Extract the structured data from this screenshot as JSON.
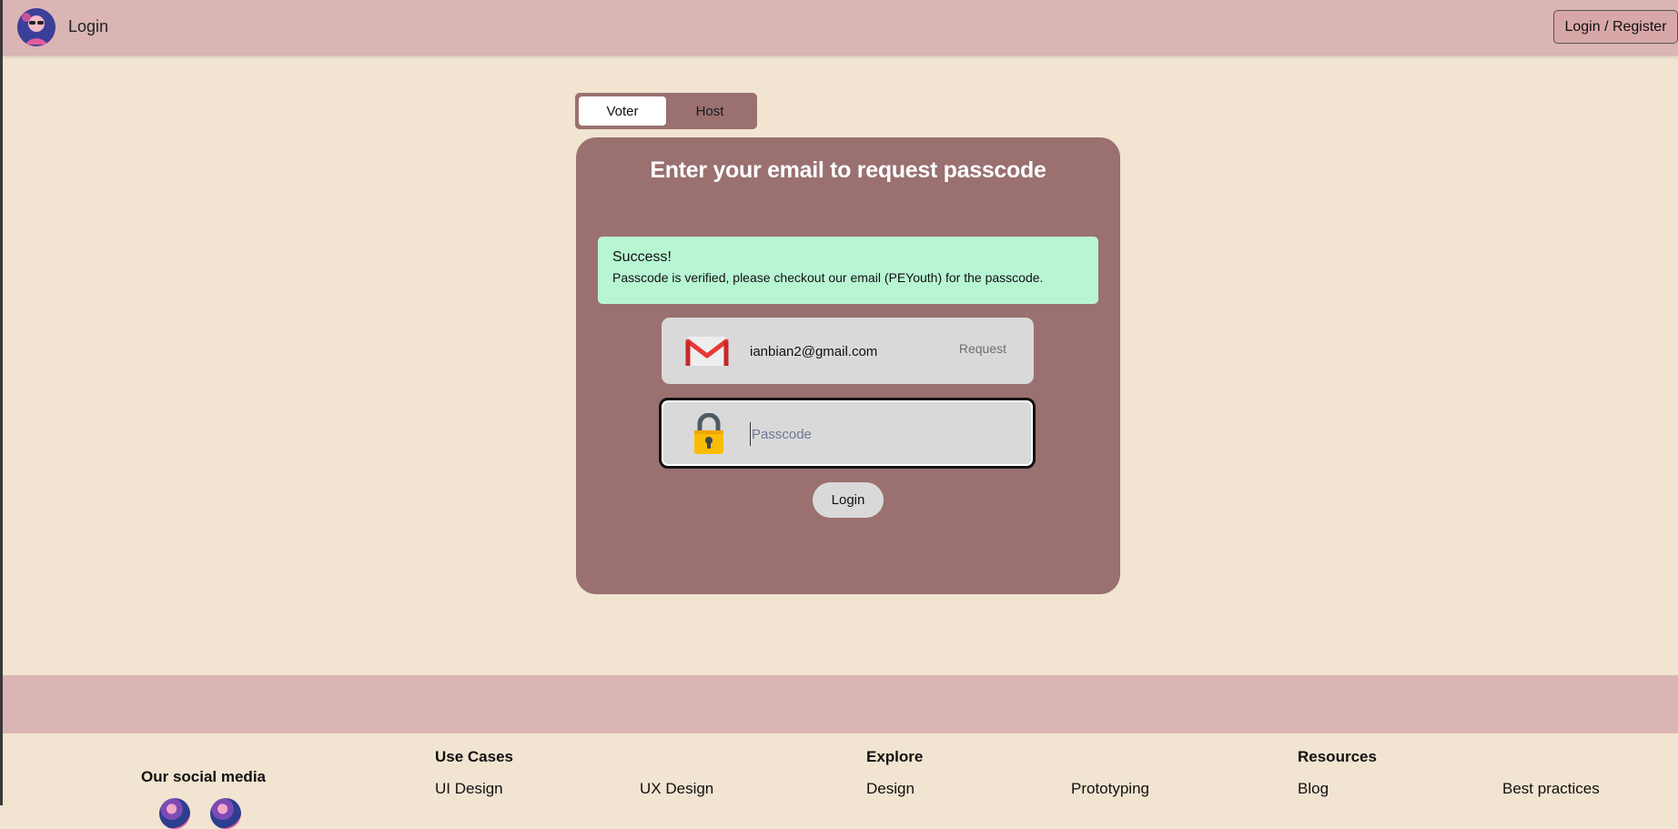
{
  "header": {
    "title": "Login",
    "login_register_label": "Login / Register"
  },
  "role_toggle": {
    "voter_label": "Voter",
    "host_label": "Host",
    "selected": "Voter"
  },
  "card": {
    "title": "Enter your email to request passcode",
    "alert": {
      "title": "Success!",
      "message": "Passcode is verified, please checkout our email (PEYouth) for the passcode."
    },
    "email": {
      "value": "ianbian2@gmail.com",
      "icon": "gmail-icon",
      "request_label": "Request"
    },
    "passcode": {
      "placeholder": "Passcode",
      "value": "",
      "icon": "lock-icon"
    },
    "login_label": "Login"
  },
  "footer": {
    "social_title": "Our social media",
    "columns": [
      {
        "heading": "Use Cases",
        "links": [
          "UI Design",
          "UX Design"
        ]
      },
      {
        "heading": "Explore",
        "links": [
          "Design",
          "Prototyping"
        ]
      },
      {
        "heading": "Resources",
        "links": [
          "Blog",
          "Best practices"
        ]
      }
    ]
  },
  "colors": {
    "page_bg": "#f1e4d1",
    "header_bg": "#dbb4b4",
    "card_bg": "#9a7070",
    "alert_bg": "#b8f5d3",
    "field_bg": "#d9d9d9"
  }
}
